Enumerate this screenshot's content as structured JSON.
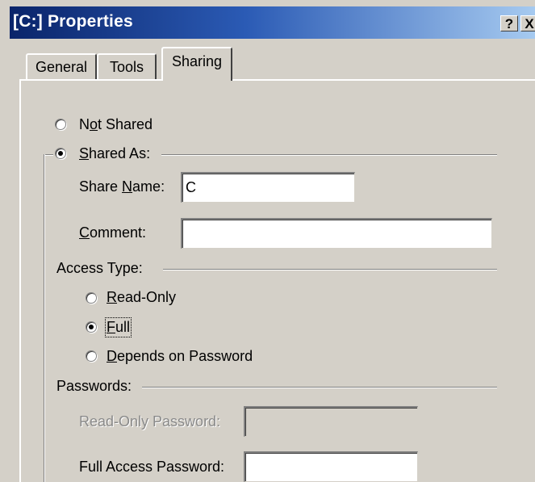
{
  "window": {
    "title": "[C:] Properties"
  },
  "titlebar_buttons": {
    "help": "?",
    "close": "X"
  },
  "tabs": [
    {
      "label": "General"
    },
    {
      "label": "Tools"
    },
    {
      "label": "Sharing",
      "selected": true
    }
  ],
  "sharing": {
    "not_shared": {
      "pre": "N",
      "mnemonic": "o",
      "post": "t Shared",
      "selected": false
    },
    "shared_as": {
      "mnemonic": "S",
      "post": "hared As:",
      "selected": true
    },
    "share_name": {
      "pre": "Share ",
      "mnemonic": "N",
      "post": "ame:",
      "value": "C"
    },
    "comment": {
      "mnemonic": "C",
      "post": "omment:",
      "value": ""
    },
    "access_type": {
      "label": "Access Type:",
      "read_only": {
        "mnemonic": "R",
        "post": "ead-Only",
        "selected": false
      },
      "full": {
        "mnemonic": "F",
        "post": "ull",
        "selected": true
      },
      "depends": {
        "mnemonic": "D",
        "post": "epends on Password",
        "selected": false
      }
    },
    "passwords": {
      "label": "Passwords:",
      "read_only_password": {
        "label": "Read-Only Password:",
        "value": "",
        "enabled": false
      },
      "full_access_password": {
        "label": "Full Access Password:",
        "value": "",
        "enabled": true
      }
    }
  },
  "colors": {
    "dialog_face": "#d4d0c8",
    "title_gradient_start": "#0a246a",
    "title_gradient_end": "#a6caf0",
    "disabled_text": "#8a8a8a"
  }
}
